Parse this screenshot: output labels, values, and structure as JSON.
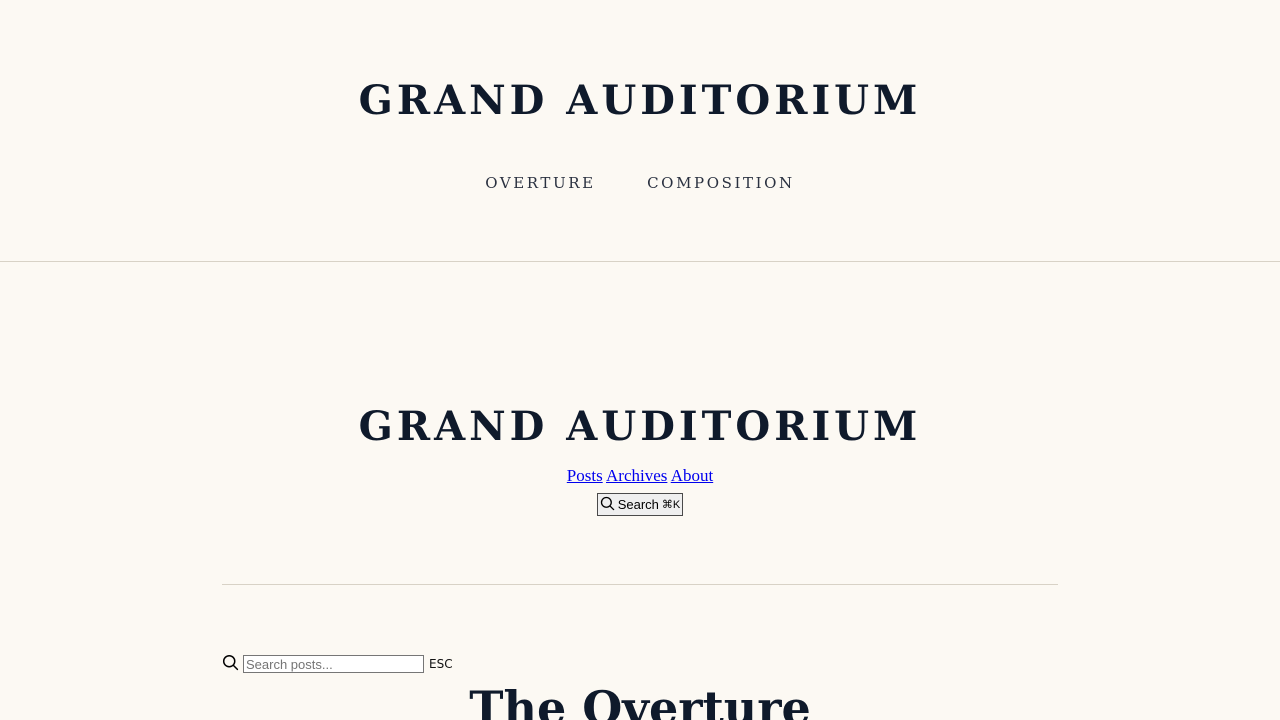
{
  "site": {
    "title": "GRAND AUDITORIUM"
  },
  "top_nav": {
    "items": [
      {
        "label": "OVERTURE"
      },
      {
        "label": "COMPOSITION"
      }
    ]
  },
  "sub_header": {
    "title": "GRAND AUDITORIUM",
    "links": [
      {
        "label": "Posts"
      },
      {
        "label": "Archives"
      },
      {
        "label": "About"
      }
    ],
    "search_button": {
      "label": "Search",
      "shortcut": "⌘K",
      "icon": "search-icon"
    }
  },
  "search": {
    "placeholder": "Search posts...",
    "value": "",
    "esc_label": "ESC",
    "icon": "search-icon"
  },
  "post": {
    "title": "The Overture"
  },
  "colors": {
    "background": "#fcf9f3",
    "title": "#0f1a2b",
    "link": "#0000ee",
    "divider": "#d8d2c6"
  }
}
